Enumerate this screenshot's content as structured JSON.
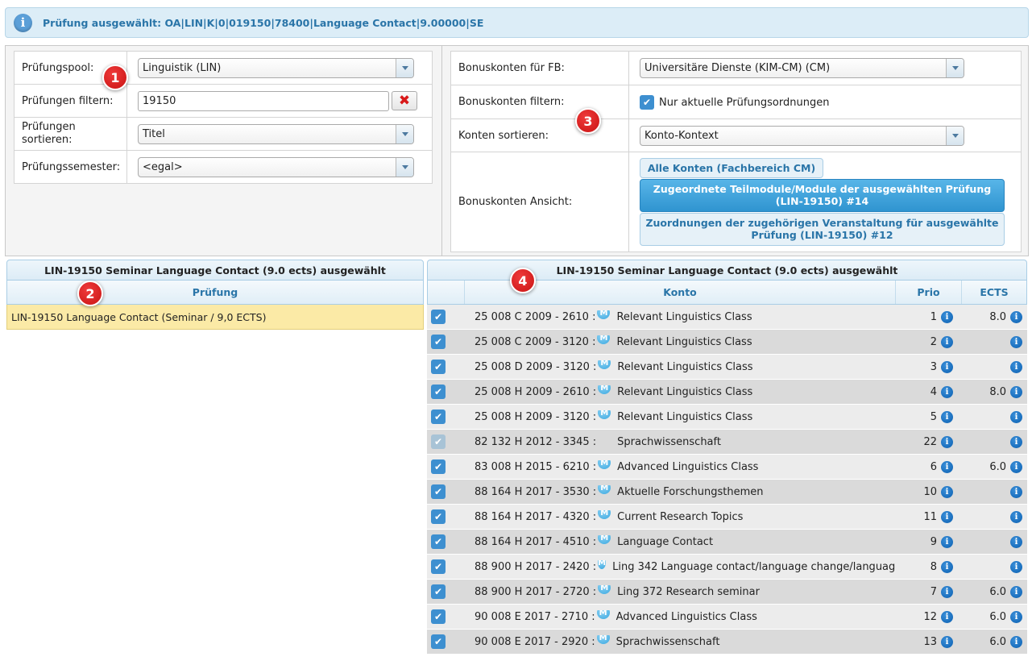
{
  "infobar": {
    "text": "Prüfung ausgewählt: OA|LIN|K|0|019150|78400|Language Contact|9.00000|SE"
  },
  "left_filters": {
    "pool_label": "Prüfungspool:",
    "pool_value": "Linguistik (LIN)",
    "filter_label": "Prüfungen filtern:",
    "filter_value": "19150",
    "sort_label": "Prüfungen sortieren:",
    "sort_value": "Titel",
    "semester_label": "Prüfungssemester:",
    "semester_value": "<egal>"
  },
  "right_filters": {
    "fb_label": "Bonuskonten für FB:",
    "fb_value": "Universitäre Dienste (KIM-CM) (CM)",
    "filter_label": "Bonuskonten filtern:",
    "filter_checkbox_label": "Nur aktuelle Prüfungsordnungen",
    "sort_label": "Konten sortieren:",
    "sort_value": "Konto-Kontext",
    "view_label": "Bonuskonten Ansicht:",
    "view_buttons": [
      "Alle Konten (Fachbereich CM)",
      "Zugeordnete Teilmodule/Module der ausgewählten Prüfung (LIN-19150) #14",
      "Zuordnungen der zugehörigen Veranstaltung für ausgewählte Prüfung (LIN-19150) #12"
    ]
  },
  "markers": [
    "1",
    "2",
    "3",
    "4"
  ],
  "exam_grid": {
    "title": "LIN-19150 Seminar Language Contact (9.0 ects) ausgewählt",
    "header": "Prüfung",
    "rows": [
      "LIN-19150 Language Contact (Seminar / 9,0 ECTS)"
    ]
  },
  "account_grid": {
    "title": "LIN-19150 Seminar Language Contact (9.0 ects) ausgewählt",
    "headers": {
      "konto": "Konto",
      "prio": "Prio",
      "ects": "ECTS"
    },
    "badge": "M",
    "info_glyph": "i",
    "rows": [
      {
        "code": "25 008 C 2009 - 2610 :",
        "name": "Relevant Linguistics Class",
        "prio": "1",
        "ects": "8.0",
        "badge": true,
        "checked": true
      },
      {
        "code": "25 008 C 2009 - 3120 :",
        "name": "Relevant Linguistics Class",
        "prio": "2",
        "ects": "",
        "badge": true,
        "checked": true
      },
      {
        "code": "25 008 D 2009 - 3120 :",
        "name": "Relevant Linguistics Class",
        "prio": "3",
        "ects": "",
        "badge": true,
        "checked": true
      },
      {
        "code": "25 008 H 2009 - 2610 :",
        "name": "Relevant Linguistics Class",
        "prio": "4",
        "ects": "8.0",
        "badge": true,
        "checked": true
      },
      {
        "code": "25 008 H 2009 - 3120 :",
        "name": "Relevant Linguistics Class",
        "prio": "5",
        "ects": "",
        "badge": true,
        "checked": true
      },
      {
        "code": "82 132 H 2012 - 3345 :",
        "name": "Sprachwissenschaft",
        "prio": "22",
        "ects": "",
        "badge": false,
        "checked": false
      },
      {
        "code": "83 008 H 2015 - 6210 :",
        "name": "Advanced Linguistics Class",
        "prio": "6",
        "ects": "6.0",
        "badge": true,
        "checked": true
      },
      {
        "code": "88 164 H 2017 - 3530 :",
        "name": "Aktuelle Forschungsthemen",
        "prio": "10",
        "ects": "",
        "badge": true,
        "checked": true
      },
      {
        "code": "88 164 H 2017 - 4320 :",
        "name": "Current Research Topics",
        "prio": "11",
        "ects": "",
        "badge": true,
        "checked": true
      },
      {
        "code": "88 164 H 2017 - 4510 :",
        "name": "Language Contact",
        "prio": "9",
        "ects": "",
        "badge": true,
        "checked": true
      },
      {
        "code": "88 900 H 2017 - 2420 :",
        "name": "Ling 342 Language contact/language change/languag",
        "prio": "8",
        "ects": "",
        "badge": true,
        "checked": true
      },
      {
        "code": "88 900 H 2017 - 2720 :",
        "name": "Ling 372 Research seminar",
        "prio": "7",
        "ects": "6.0",
        "badge": true,
        "checked": true
      },
      {
        "code": "90 008 E 2017 - 2710 :",
        "name": "Advanced Linguistics Class",
        "prio": "12",
        "ects": "6.0",
        "badge": true,
        "checked": true
      },
      {
        "code": "90 008 E 2017 - 2920 :",
        "name": "Sprachwissenschaft",
        "prio": "13",
        "ects": "6.0",
        "badge": true,
        "checked": true
      }
    ]
  }
}
